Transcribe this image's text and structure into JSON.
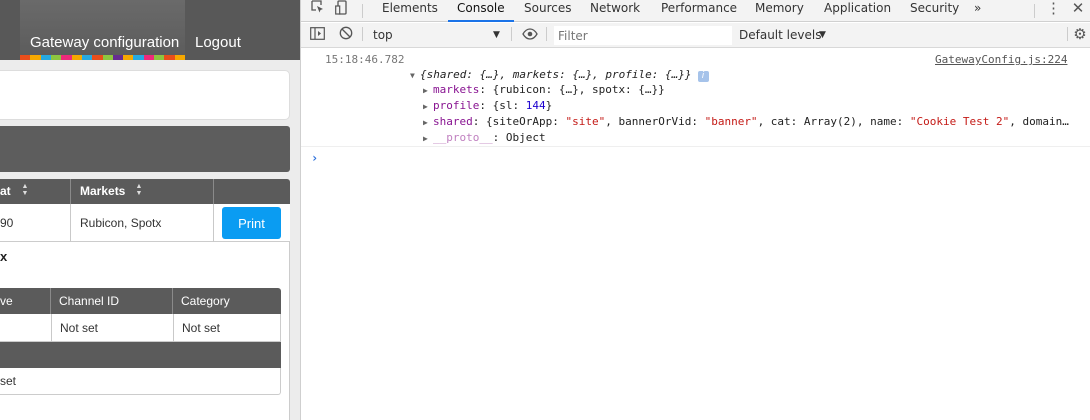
{
  "page": {
    "nav": {
      "gateway_label": "Gateway configuration",
      "logout_label": "Logout"
    },
    "stripe_colors": [
      "#e94e1b",
      "#f6a800",
      "#26a9e0",
      "#8dc63f",
      "#ee2a7b",
      "#f6a800",
      "#26a9e0",
      "#e94e1b",
      "#8dc63f",
      "#662d91",
      "#f6a800",
      "#26a9e0",
      "#ee2a7b",
      "#8dc63f",
      "#e94e1b",
      "#f6a800"
    ],
    "table": {
      "headers": [
        "at",
        "Markets"
      ],
      "row": [
        "90",
        "Rubicon, Spotx"
      ],
      "print_label": "Print"
    },
    "section_title": "x",
    "subtable": {
      "headers": [
        "ve",
        "Channel ID",
        "Category"
      ],
      "row": [
        "",
        "Not set",
        "Not set"
      ],
      "row2": "set"
    }
  },
  "devtools": {
    "tabs": [
      "Elements",
      "Console",
      "Sources",
      "Network",
      "Performance",
      "Memory",
      "Application",
      "Security"
    ],
    "active_tab": "Console",
    "more_tabs": "»",
    "context": "top",
    "filter_placeholder": "Filter",
    "levels": "Default levels",
    "colors": {
      "active_tab_underline": "#1a73e8",
      "string": "#c41a16",
      "number": "#1c00cf",
      "key": "#881391"
    }
  },
  "console": {
    "timestamp": "15:18:46.782",
    "source": "GatewayConfig.js:224",
    "summary": "{shared: {…}, markets: {…}, profile: {…}}",
    "info_badge": "i",
    "lines": {
      "markets_key": "markets",
      "markets_val": "{rubicon: {…}, spotx: {…}}",
      "profile_key": "profile",
      "profile_pre": "{sl: ",
      "profile_num": "144",
      "profile_post": "}",
      "shared_key": "shared",
      "shared_p1": "{siteOrApp: ",
      "shared_s1": "\"site\"",
      "shared_p2": ", bannerOrVid: ",
      "shared_s2": "\"banner\"",
      "shared_p3": ", cat: Array(2), name: ",
      "shared_s3": "\"Cookie Test 2\"",
      "shared_p4": ", domain…",
      "proto_key": "__proto__",
      "proto_val": ": Object"
    },
    "prompt": "›"
  }
}
